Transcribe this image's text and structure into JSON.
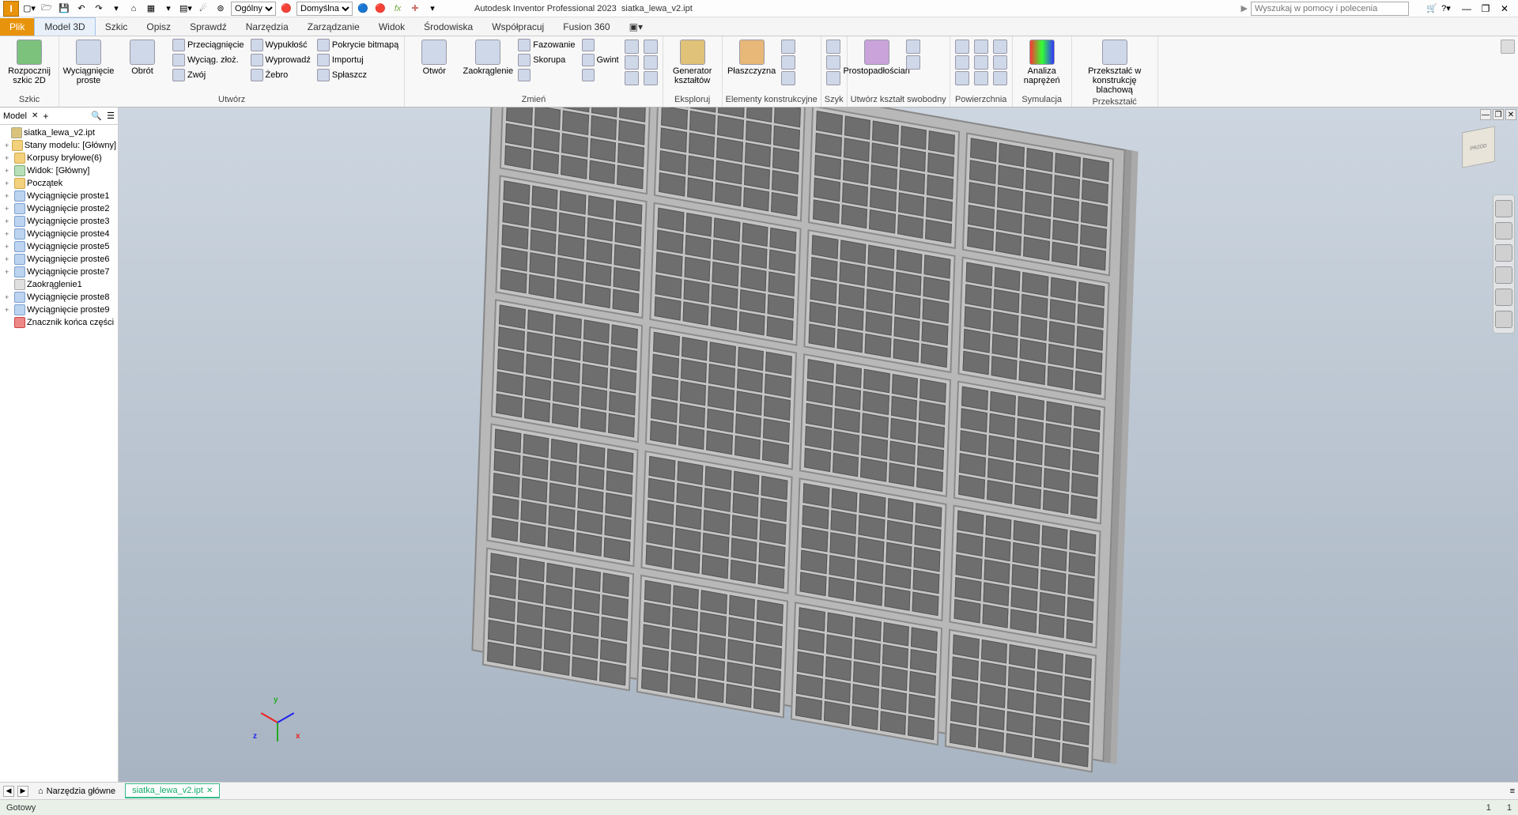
{
  "app": {
    "logo_letter": "I",
    "title": "Autodesk Inventor Professional 2023",
    "document": "siatka_lewa_v2.ipt",
    "search_placeholder": "Wyszukaj w pomocy i polecenia"
  },
  "qat": {
    "style_dropdown": "Ogólny",
    "appearance_dropdown": "Domyślna"
  },
  "ribbon_tabs": {
    "file": "Plik",
    "items": [
      "Model 3D",
      "Szkic",
      "Opisz",
      "Sprawdź",
      "Narzędzia",
      "Zarządzanie",
      "Widok",
      "Środowiska",
      "Współpracuj",
      "Fusion 360"
    ],
    "active_index": 0
  },
  "ribbon": {
    "panels": [
      {
        "title": "Szkic",
        "big": [
          {
            "label": "Rozpocznij szkic 2D"
          }
        ]
      },
      {
        "title": "Utwórz",
        "big": [
          {
            "label": "Wyciągnięcie proste"
          },
          {
            "label": "Obrót"
          }
        ],
        "cols": [
          [
            "Przeciągnięcie",
            "Wyciąg. złoż.",
            "Zwój"
          ],
          [
            "Wypukłość",
            "Wyprowadź",
            "Żebro"
          ],
          [
            "Pokrycie bitmapą",
            "Importuj",
            "Spłaszcz"
          ]
        ]
      },
      {
        "title": "Zmień",
        "big": [
          {
            "label": "Otwór"
          },
          {
            "label": "Zaokrąglenie"
          }
        ],
        "cols": [
          [
            "Fazowanie",
            "Skorupa",
            ""
          ],
          [
            "",
            "Gwint",
            ""
          ]
        ]
      },
      {
        "title": "Eksploruj",
        "big": [
          {
            "label": "Generator kształtów"
          }
        ]
      },
      {
        "title": "Elementy konstrukcyjne",
        "big": [
          {
            "label": "Płaszczyzna"
          }
        ]
      },
      {
        "title": "Szyk",
        "big": []
      },
      {
        "title": "Utwórz kształt swobodny",
        "big": [
          {
            "label": "Prostopadłościan"
          }
        ]
      },
      {
        "title": "Powierzchnia",
        "big": []
      },
      {
        "title": "Symulacja",
        "big": [
          {
            "label": "Analiza naprężeń"
          }
        ]
      },
      {
        "title": "Przekształć",
        "big": [
          {
            "label": "Przekształć w konstrukcję blachową"
          }
        ]
      }
    ]
  },
  "browser": {
    "tab": "Model",
    "root": "siatka_lewa_v2.ipt",
    "nodes": [
      {
        "icon": "folder",
        "label": "Stany modelu: [Główny]",
        "exp": "+"
      },
      {
        "icon": "folder",
        "label": "Korpusy bryłowe(6)",
        "exp": "+"
      },
      {
        "icon": "view",
        "label": "Widok: [Główny]",
        "exp": "+"
      },
      {
        "icon": "folder",
        "label": "Początek",
        "exp": "+"
      },
      {
        "icon": "feat",
        "label": "Wyciągnięcie proste1",
        "exp": "+"
      },
      {
        "icon": "feat",
        "label": "Wyciągnięcie proste2",
        "exp": "+"
      },
      {
        "icon": "feat",
        "label": "Wyciągnięcie proste3",
        "exp": "+"
      },
      {
        "icon": "feat",
        "label": "Wyciągnięcie proste4",
        "exp": "+"
      },
      {
        "icon": "feat",
        "label": "Wyciągnięcie proste5",
        "exp": "+"
      },
      {
        "icon": "feat",
        "label": "Wyciągnięcie proste6",
        "exp": "+"
      },
      {
        "icon": "feat",
        "label": "Wyciągnięcie proste7",
        "exp": "+"
      },
      {
        "icon": "fillet",
        "label": "Zaokrąglenie1",
        "exp": ""
      },
      {
        "icon": "feat",
        "label": "Wyciągnięcie proste8",
        "exp": "+"
      },
      {
        "icon": "feat",
        "label": "Wyciągnięcie proste9",
        "exp": "+"
      },
      {
        "icon": "end",
        "label": "Znacznik końca części",
        "exp": ""
      }
    ]
  },
  "triad": {
    "x": "x",
    "y": "y",
    "z": "z"
  },
  "viewcube": {
    "front": "PRZÓD"
  },
  "doctabs": {
    "home": "Narzędzia główne",
    "active": "siatka_lewa_v2.ipt"
  },
  "status": {
    "left": "Gotowy",
    "right_num": "1"
  }
}
